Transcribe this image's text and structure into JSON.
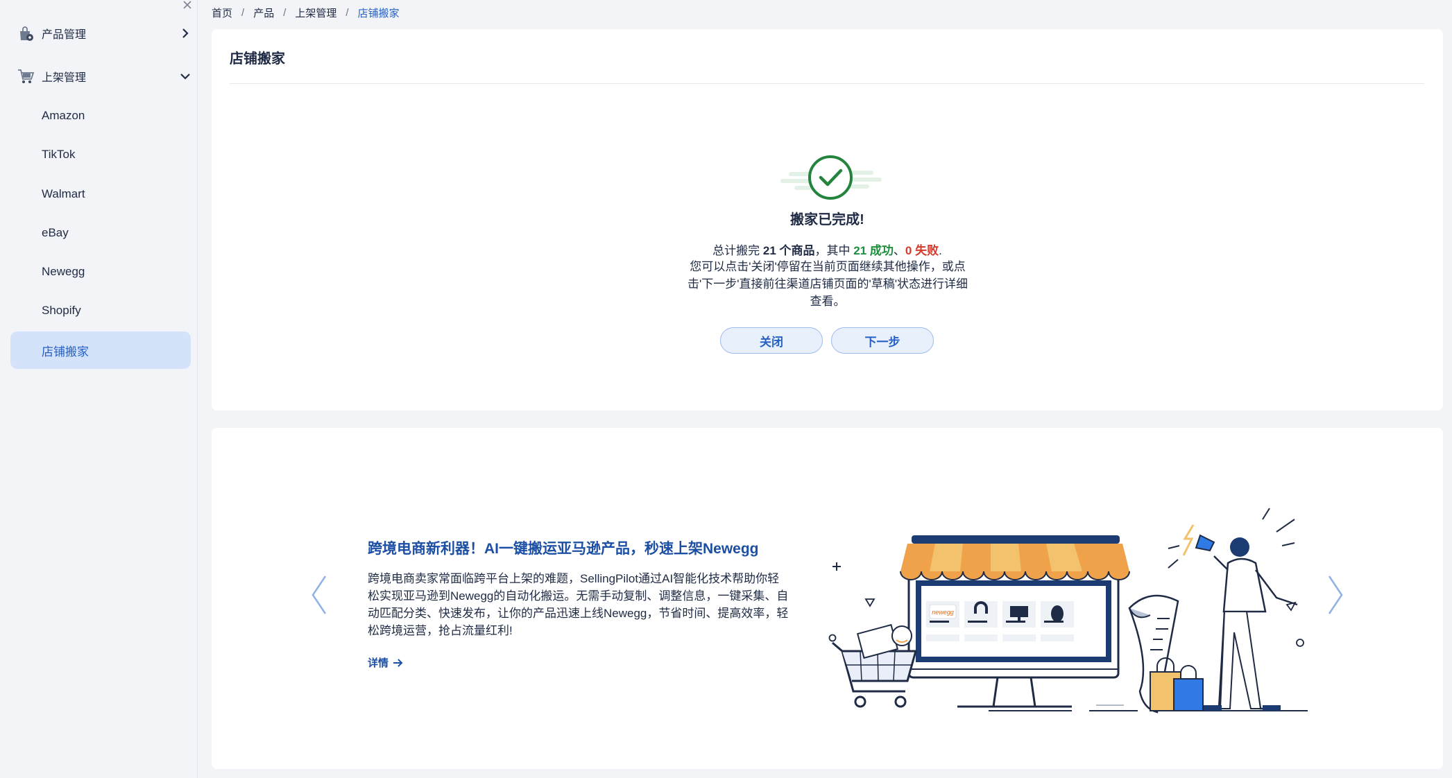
{
  "sidebar": {
    "groups": [
      {
        "label": "产品管理",
        "icon": "shopping-bag-gear-icon",
        "arrow": "chevron-right-icon"
      },
      {
        "label": "上架管理",
        "icon": "shopping-cart-icon",
        "arrow": "chevron-down-icon"
      }
    ],
    "items": [
      {
        "label": "Amazon"
      },
      {
        "label": "TikTok"
      },
      {
        "label": "Walmart"
      },
      {
        "label": "eBay"
      },
      {
        "label": "Newegg"
      },
      {
        "label": "Shopify"
      },
      {
        "label": "店铺搬家",
        "active": true
      }
    ]
  },
  "breadcrumb": [
    "首页",
    "产品",
    "上架管理",
    "店铺搬家"
  ],
  "page": {
    "title": "店铺搬家",
    "result": {
      "title": "搬家已完成!",
      "summary_prefix": "总计搬完 ",
      "total": "21 个商品",
      "summary_mid": "，其中 ",
      "success": "21 成功",
      "sep": "、",
      "fail": "0 失败",
      "summary_end": ".",
      "desc": "您可以点击'关闭'停留在当前页面继续其他操作，或点击'下一步'直接前往渠道店铺页面的'草稿'状态进行详细查看。",
      "close_label": "关闭",
      "next_label": "下一步"
    }
  },
  "promo": {
    "title": "跨境电商新利器！AI一键搬运亚马逊产品，秒速上架Newegg",
    "text": "跨境电商卖家常面临跨平台上架的难题，SellingPilot通过AI智能化技术帮助你轻松实现亚马逊到Newegg的自动化搬运。无需手动复制、调整信息，一键采集、自动匹配分类、快速发布，让你的产品迅速上线Newegg，节省时间、提高效率，轻松跨境运营，抢占流量红利!",
    "link_label": "详情",
    "badge_text": "newegg"
  },
  "colors": {
    "accent": "#2660c4",
    "success": "#1d8f3c",
    "fail": "#d63a2a",
    "active_bg": "#d4e3fa",
    "awning_orange": "#f0a24a",
    "awning_yellow": "#f2c26d"
  }
}
